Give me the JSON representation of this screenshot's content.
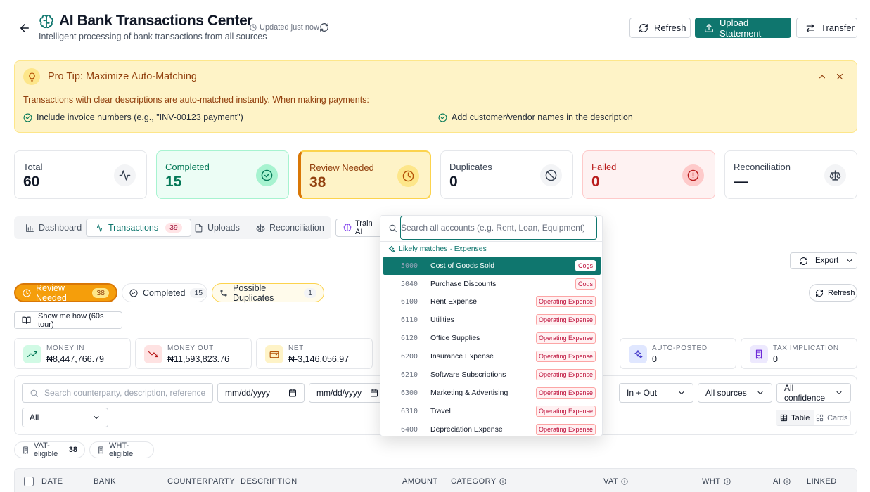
{
  "header": {
    "title": "AI Bank Transactions Center",
    "subtitle": "Intelligent processing of bank transactions from all sources",
    "updated": "Updated just now",
    "refresh_label": "Refresh",
    "upload_label": "Upload Statement",
    "transfer_label": "Transfer"
  },
  "tip": {
    "title": "Pro Tip: Maximize Auto-Matching",
    "body": "Transactions with clear descriptions are auto-matched instantly. When making payments:",
    "items": [
      "Include invoice numbers (e.g., \"INV-00123 payment\")",
      "Add customer/vendor names in the description"
    ]
  },
  "stats": {
    "total": {
      "label": "Total",
      "value": "60"
    },
    "completed": {
      "label": "Completed",
      "value": "15"
    },
    "review": {
      "label": "Review Needed",
      "value": "38"
    },
    "duplicates": {
      "label": "Duplicates",
      "value": "0"
    },
    "failed": {
      "label": "Failed",
      "value": "0"
    },
    "reconciliation": {
      "label": "Reconciliation",
      "value": "—"
    }
  },
  "tabs": [
    {
      "label": "Dashboard"
    },
    {
      "label": "Transactions",
      "badge": "39"
    },
    {
      "label": "Uploads"
    },
    {
      "label": "Reconciliation"
    }
  ],
  "train_label": "Train AI",
  "export_label": "Export",
  "pills": {
    "review": {
      "label": "Review Needed",
      "count": "38"
    },
    "completed": {
      "label": "Completed",
      "count": "15"
    },
    "duplicates": {
      "label": "Possible Duplicates",
      "count": "1"
    }
  },
  "refresh2_label": "Refresh",
  "howto_label": "Show me how (60s tour)",
  "summary": {
    "money_in": {
      "label": "MONEY IN",
      "value": "₦8,447,766.79"
    },
    "money_out": {
      "label": "MONEY OUT",
      "value": "₦11,593,823.76"
    },
    "net": {
      "label": "NET",
      "value": "₦-3,146,056.97"
    },
    "auto_posted": {
      "label": "AUTO-POSTED",
      "value": "0"
    },
    "tax": {
      "label": "TAX IMPLICATION",
      "value": "0"
    }
  },
  "filters": {
    "search_placeholder": "Search counterparty, description, reference...",
    "date_placeholder": "mm/dd/yyyy",
    "direction": "In + Out",
    "source": "All sources",
    "confidence": "All confidence",
    "category": "All",
    "view_table": "Table",
    "view_cards": "Cards"
  },
  "chips": {
    "vat": {
      "label": "VAT-eligible",
      "count": "38"
    },
    "wht": {
      "label": "WHT-eligible"
    }
  },
  "table": {
    "columns": [
      "DATE",
      "BANK",
      "COUNTERPARTY",
      "DESCRIPTION",
      "AMOUNT",
      "CATEGORY",
      "VAT",
      "WHT",
      "AI",
      "LINKED"
    ]
  },
  "dropdown": {
    "placeholder": "Search all accounts (e.g. Rent, Loan, Equipment)...",
    "group_label": "Likely matches · Expenses",
    "options": [
      {
        "code": "5000",
        "name": "Cost of Goods Sold",
        "tag": "Cogs"
      },
      {
        "code": "5040",
        "name": "Purchase Discounts",
        "tag": "Cogs"
      },
      {
        "code": "6100",
        "name": "Rent Expense",
        "tag": "Operating Expense"
      },
      {
        "code": "6110",
        "name": "Utilities",
        "tag": "Operating Expense"
      },
      {
        "code": "6120",
        "name": "Office Supplies",
        "tag": "Operating Expense"
      },
      {
        "code": "6200",
        "name": "Insurance Expense",
        "tag": "Operating Expense"
      },
      {
        "code": "6210",
        "name": "Software Subscriptions",
        "tag": "Operating Expense"
      },
      {
        "code": "6300",
        "name": "Marketing & Advertising",
        "tag": "Operating Expense"
      },
      {
        "code": "6310",
        "name": "Travel",
        "tag": "Operating Expense"
      },
      {
        "code": "6400",
        "name": "Depreciation Expense",
        "tag": "Operating Expense"
      }
    ]
  },
  "colors": {
    "brand": "#0f766e",
    "warning": "#d97706",
    "danger": "#b91c1c",
    "success": "#047857"
  }
}
